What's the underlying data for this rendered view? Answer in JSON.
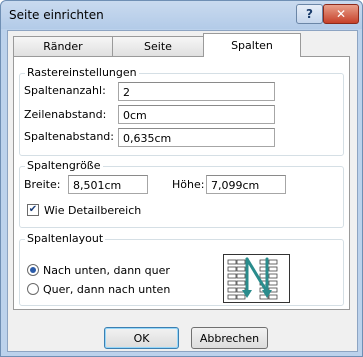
{
  "window": {
    "title": "Seite einrichten"
  },
  "titlebar": {
    "help_label": "?",
    "close_label": "✕"
  },
  "tabs": [
    {
      "label": "Ränder",
      "active": false
    },
    {
      "label": "Seite",
      "active": false
    },
    {
      "label": "Spalten",
      "active": true
    }
  ],
  "raster": {
    "legend": "Rastereinstellungen",
    "columns_label": "Spaltenanzahl:",
    "columns_value": "2",
    "row_spacing_label": "Zeilenabstand:",
    "row_spacing_value": "0cm",
    "column_spacing_label": "Spaltenabstand:",
    "column_spacing_value": "0,635cm"
  },
  "column_size": {
    "legend": "Spaltengröße",
    "width_label": "Breite:",
    "width_value": "8,501cm",
    "height_label": "Höhe:",
    "height_value": "7,099cm",
    "same_as_detail_label": "Wie Detailbereich",
    "same_as_detail_checked": true
  },
  "layout": {
    "legend": "Spaltenlayout",
    "option_down_then_across": "Nach unten, dann quer",
    "option_across_then_down": "Quer, dann nach unten",
    "selected": "down_then_across"
  },
  "buttons": {
    "ok": "OK",
    "cancel": "Abbrechen"
  },
  "colors": {
    "accent": "#2a5aa8",
    "arrow": "#2a8c8c"
  },
  "icons": {
    "help": "help-icon",
    "close": "close-icon",
    "check": "checkmark-icon",
    "preview": "column-layout-preview-icon"
  }
}
